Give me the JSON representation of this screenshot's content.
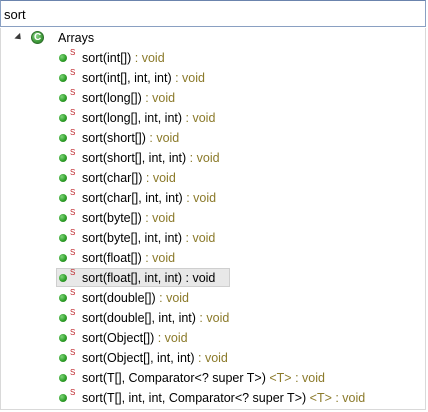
{
  "search": {
    "value": "sort"
  },
  "tree": {
    "root": {
      "label": "Arrays",
      "expanded": true,
      "icon": "class-icon"
    },
    "items": [
      {
        "name": "sort(int[])",
        "generic": "",
        "ret": " : void"
      },
      {
        "name": "sort(int[], int, int)",
        "generic": "",
        "ret": " : void"
      },
      {
        "name": "sort(long[])",
        "generic": "",
        "ret": " : void"
      },
      {
        "name": "sort(long[], int, int)",
        "generic": "",
        "ret": " : void"
      },
      {
        "name": "sort(short[])",
        "generic": "",
        "ret": " : void"
      },
      {
        "name": "sort(short[], int, int)",
        "generic": "",
        "ret": " : void"
      },
      {
        "name": "sort(char[])",
        "generic": "",
        "ret": " : void"
      },
      {
        "name": "sort(char[], int, int)",
        "generic": "",
        "ret": " : void"
      },
      {
        "name": "sort(byte[])",
        "generic": "",
        "ret": " : void"
      },
      {
        "name": "sort(byte[], int, int)",
        "generic": "",
        "ret": " : void"
      },
      {
        "name": "sort(float[])",
        "generic": "",
        "ret": " : void"
      },
      {
        "name": "sort(float[], int, int)",
        "generic": "",
        "ret": " : void",
        "selected": true
      },
      {
        "name": "sort(double[])",
        "generic": "",
        "ret": " : void"
      },
      {
        "name": "sort(double[], int, int)",
        "generic": "",
        "ret": " : void"
      },
      {
        "name": "sort(Object[])",
        "generic": "",
        "ret": " : void"
      },
      {
        "name": "sort(Object[], int, int)",
        "generic": "",
        "ret": " : void"
      },
      {
        "name": "sort(T[], Comparator<? super T>)",
        "generic": " <T>",
        "ret": " : void"
      },
      {
        "name": "sort(T[], int, int, Comparator<? super T>)",
        "generic": " <T>",
        "ret": " : void"
      }
    ],
    "static_marker": "S"
  },
  "colors": {
    "method_dot": "#31a12b",
    "static_marker": "#c0272d",
    "return_type": "#8b7a2a",
    "selection": "#e8e8e8"
  }
}
